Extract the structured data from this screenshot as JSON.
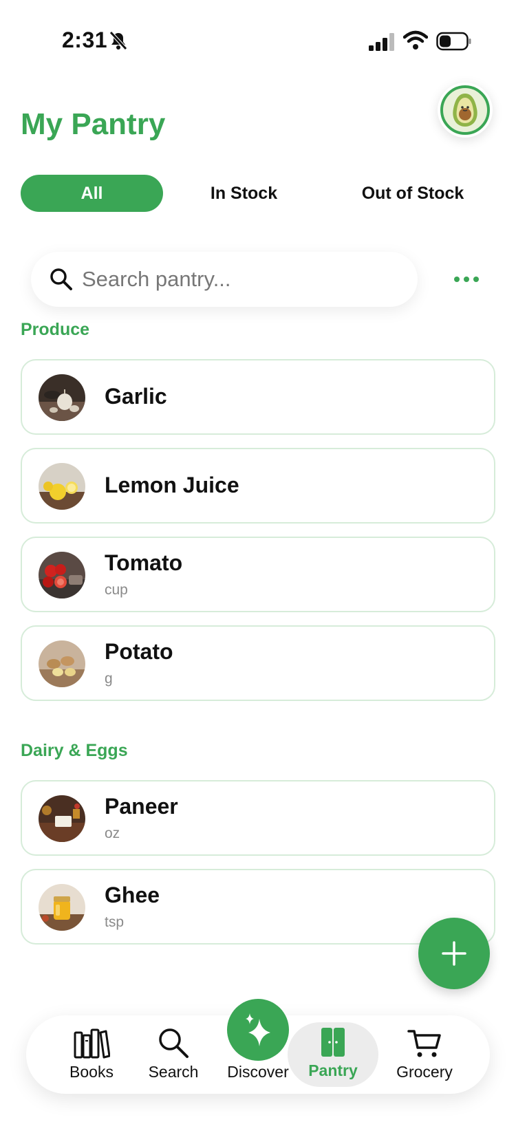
{
  "status_bar": {
    "time": "2:31"
  },
  "header": {
    "title": "My Pantry"
  },
  "tabs": [
    {
      "label": "All",
      "active": true
    },
    {
      "label": "In Stock",
      "active": false
    },
    {
      "label": "Out of Stock",
      "active": false
    }
  ],
  "search": {
    "placeholder": "Search pantry..."
  },
  "sections": [
    {
      "label": "Produce",
      "items": [
        {
          "name": "Garlic",
          "unit": ""
        },
        {
          "name": "Lemon Juice",
          "unit": ""
        },
        {
          "name": "Tomato",
          "unit": "cup"
        },
        {
          "name": "Potato",
          "unit": "g"
        }
      ]
    },
    {
      "label": "Dairy & Eggs",
      "items": [
        {
          "name": "Paneer",
          "unit": "oz"
        },
        {
          "name": "Ghee",
          "unit": "tsp"
        }
      ]
    }
  ],
  "bottom_nav": [
    {
      "label": "Books",
      "icon": "books-icon"
    },
    {
      "label": "Search",
      "icon": "search-icon"
    },
    {
      "label": "Discover",
      "icon": "sparkle-icon"
    },
    {
      "label": "Pantry",
      "icon": "pantry-icon",
      "active": true
    },
    {
      "label": "Grocery",
      "icon": "cart-icon"
    }
  ],
  "colors": {
    "accent": "#3aa655",
    "card_border": "#d6ecd9"
  }
}
